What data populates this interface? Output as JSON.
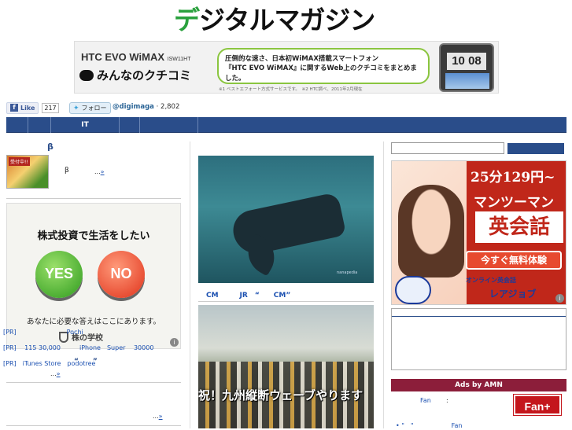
{
  "logo": {
    "de": "デ",
    "rest": "ジタルマガジン"
  },
  "banner": {
    "brand": "HTC EVO WiMAX",
    "model": "ISW11HT",
    "kuchikomi": "みんなのクチコミ",
    "bubble_line1": "圧倒的な速さ、日本初WiMAX搭載スマートフォン",
    "bubble_line2": "『HTC EVO WiMAX』に関するWeb上のクチコミをまとめました。",
    "note": "※1 ベストエフォート方式サービスです。　※2 HTC調べ、2011年2月現在",
    "clock": "10 08"
  },
  "social": {
    "fb_label": "Like",
    "fb_count": "217",
    "tw_label": "フォロー",
    "tw_handle": "@digimaga",
    "tw_count": "2,802"
  },
  "nav": {
    "items": [
      "",
      "",
      "IT",
      "",
      "",
      ""
    ]
  },
  "left": {
    "beta_title": "β",
    "thumb_tag": "受付中!!",
    "beta_text": "β",
    "more_prefix": "...",
    "more_link": "»",
    "ad_title": "株式投資で生活をしたい",
    "yes": "YES",
    "no": "NO",
    "ad_sub": "あなたに必要な答えはここにあります。",
    "ad_school": "株の学校",
    "quote": "“　　”",
    "more1_prefix": "...",
    "more1_link": "»",
    "more2_prefix": "...",
    "more2_link": "»"
  },
  "middle": {
    "whale_caption": "nanapedia",
    "cm_line": "CM　　　JR　“　　CM”",
    "wave_text": "祝！九州縦断ウェーブやります"
  },
  "right": {
    "ad_price": "25分129円~",
    "ad_man": "マンツーマン",
    "ad_eikaiwa": "英会話",
    "ad_trial": "今すぐ無料体験",
    "ad_online": "オンライン英会話",
    "ad_rarejob": "レアジョブ",
    "pr_rows": [
      "[PR]　　　　　　　　Pochi",
      "[PR]　 115  30,000　　　iPhone　Super　 30000",
      "[PR]　iTunes Store　podotree"
    ],
    "amn_header": "Ads by AMN",
    "amn_fan": "Fan",
    "amn_colon": ":",
    "fanplus": "Fan+",
    "amn_row2": "•  \"　\"　　　　　　Fan"
  },
  "colors": {
    "nav": "#2a4d8a",
    "accent_green": "#2aa13d",
    "amn": "#8c1e3a",
    "fanplus": "#c4161c"
  }
}
